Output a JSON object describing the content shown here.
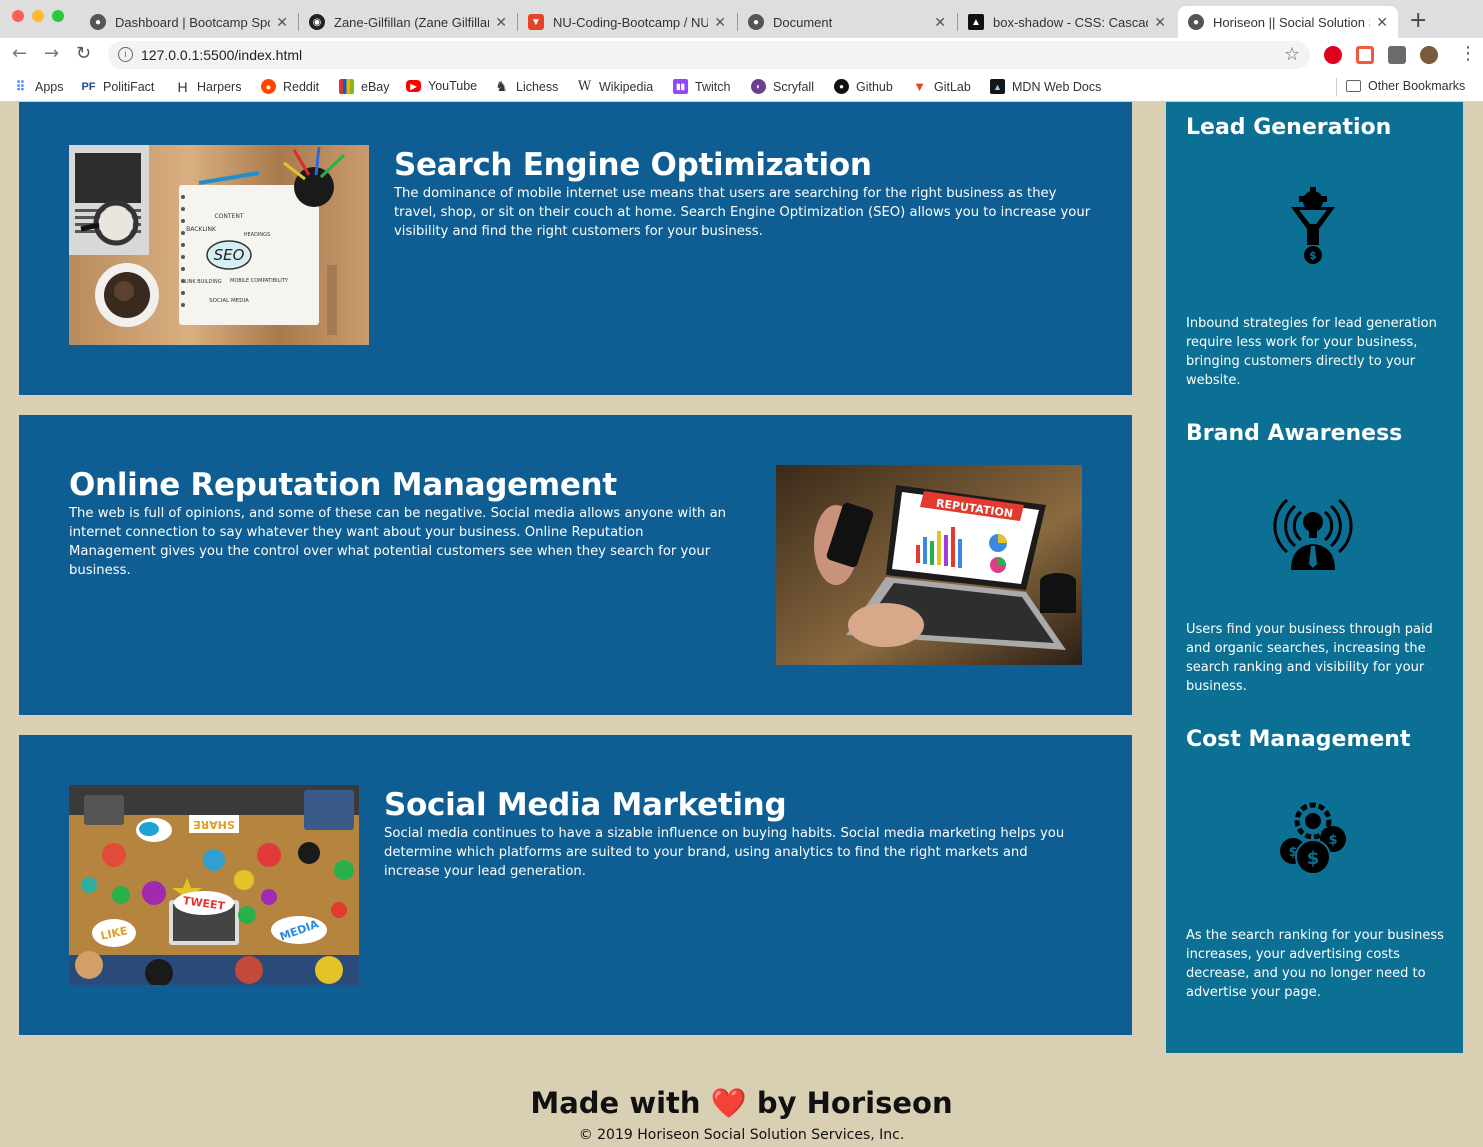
{
  "browser": {
    "tabs": [
      {
        "title": "Dashboard | Bootcamp Spo",
        "icon": "globe-icon"
      },
      {
        "title": "Zane-Gilfillan (Zane Gilfillan",
        "icon": "github-icon"
      },
      {
        "title": "NU-Coding-Bootcamp / NU",
        "icon": "gitlab-icon"
      },
      {
        "title": "Document",
        "icon": "globe-icon"
      },
      {
        "title": "box-shadow - CSS: Cascad",
        "icon": "mdn-icon"
      },
      {
        "title": "Horiseon || Social Solution S",
        "icon": "globe-icon",
        "active": true
      }
    ],
    "close_glyph": "✕",
    "new_tab_glyph": "+",
    "url": "127.0.0.1:5500/index.html",
    "bookmarks": [
      {
        "label": "Apps",
        "icon": "apps-grid-icon"
      },
      {
        "label": "PolitiFact",
        "icon": "politifact-icon"
      },
      {
        "label": "Harpers",
        "icon": "harpers-icon"
      },
      {
        "label": "Reddit",
        "icon": "reddit-icon"
      },
      {
        "label": "eBay",
        "icon": "ebay-icon"
      },
      {
        "label": "YouTube",
        "icon": "youtube-icon"
      },
      {
        "label": "Lichess",
        "icon": "lichess-icon"
      },
      {
        "label": "Wikipedia",
        "icon": "wikipedia-icon"
      },
      {
        "label": "Twitch",
        "icon": "twitch-icon"
      },
      {
        "label": "Scryfall",
        "icon": "scryfall-icon"
      },
      {
        "label": "Github",
        "icon": "github-icon"
      },
      {
        "label": "GitLab",
        "icon": "gitlab-icon"
      },
      {
        "label": "MDN Web Docs",
        "icon": "mdn-icon"
      }
    ],
    "other_bookmarks": "Other Bookmarks"
  },
  "services": [
    {
      "title": "Search Engine Optimization",
      "body": "The dominance of mobile internet use means that users are searching for the right business as they travel, shop, or sit on their couch at home. Search Engine Optimization (SEO) allows you to increase your visibility and find the right customers for your business.",
      "image_labels": [
        "CONTENT",
        "BACKLINK",
        "HEADINGS",
        "SEO",
        "LINK BUILDING",
        "MOBILE COMPATIBILITY",
        "SOCIAL MEDIA"
      ]
    },
    {
      "title": "Online Reputation Management",
      "body": "The web is full of opinions, and some of these can be negative. Social media allows anyone with an internet connection to say whatever they want about your business. Online Reputation Management gives you the control over what potential customers see when they search for your business.",
      "image_labels": [
        "REPUTATION"
      ]
    },
    {
      "title": "Social Media Marketing",
      "body": "Social media continues to have a sizable influence on buying habits. Social media marketing helps you determine which platforms are suited to your brand, using analytics to find the right markets and increase your lead generation.",
      "image_labels": [
        "SHARE",
        "TWEET",
        "LIKE",
        "MEDIA"
      ]
    }
  ],
  "benefits": [
    {
      "title": "Lead Generation",
      "icon": "lead-funnel-icon",
      "body": "Inbound strategies for lead generation require less work for your business, bringing customers directly to your website."
    },
    {
      "title": "Brand Awareness",
      "icon": "brand-lightbulb-person-icon",
      "body": "Users find your business through paid and organic searches, increasing the search ranking and visibility for your business."
    },
    {
      "title": "Cost Management",
      "icon": "cost-coins-gear-icon",
      "body": "As the search ranking for your business increases, your advertising costs decrease, and you no longer need to advertise your page."
    }
  ],
  "footer": {
    "made_with": "Made with",
    "heart": "❤️",
    "by": "by Horiseon",
    "copyright": "© 2019 Horiseon Social Solution Services, Inc."
  },
  "colors": {
    "page_bg": "#d9d0b3",
    "card_bg": "#0e5e94",
    "sidebar_bg": "#0c7095"
  }
}
